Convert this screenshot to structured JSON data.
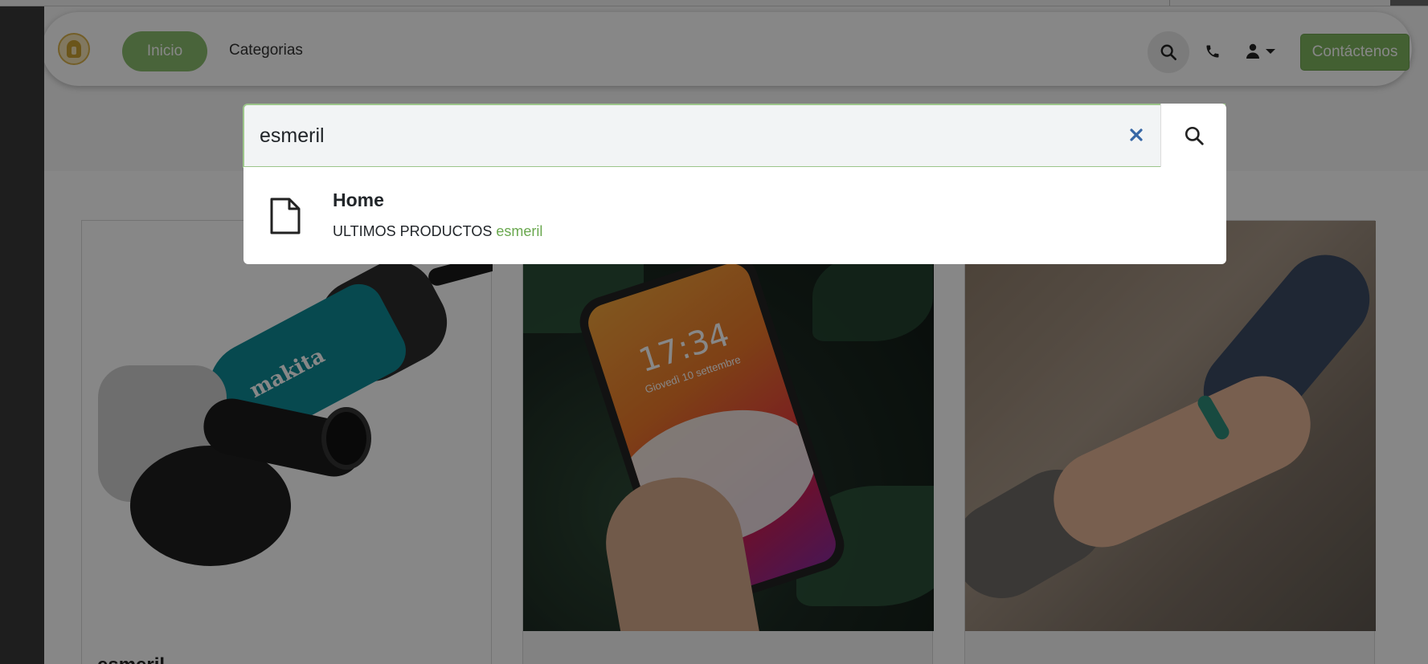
{
  "navbar": {
    "logo": "helmet-logo",
    "items": [
      {
        "label": "Inicio",
        "active": true
      },
      {
        "label": "Categorias",
        "active": false
      }
    ],
    "contact_button": "Contáctenos",
    "icons": [
      "search-icon",
      "phone-icon",
      "user-icon",
      "caret-down-icon"
    ],
    "accent_color": "#6aa84f"
  },
  "search": {
    "value": "esmeril",
    "clear_icon": "close-icon",
    "submit_icon": "search-icon"
  },
  "results": [
    {
      "icon": "document-icon",
      "title": "Home",
      "description_prefix": "ULTIMOS PRODUCTOS ",
      "description_match": "esmeril"
    }
  ],
  "products": [
    {
      "title": "esmeril",
      "image": "angle-grinder-photo"
    },
    {
      "title": "",
      "image": "smartphone-photo"
    },
    {
      "title": "",
      "image": "helping-hands-photo"
    }
  ]
}
